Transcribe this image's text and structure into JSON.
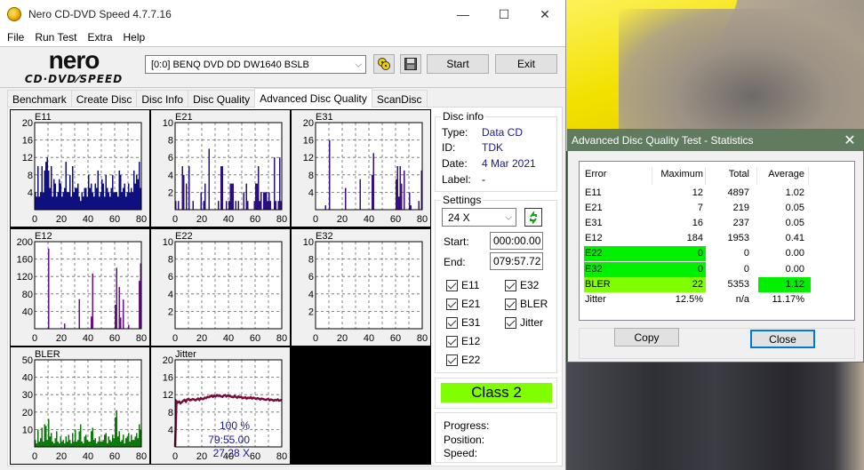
{
  "window": {
    "title": "Nero CD-DVD Speed 4.7.7.16",
    "controls": {
      "minimize": "—",
      "maximize": "☐",
      "close": "✕"
    }
  },
  "menu": [
    "File",
    "Run Test",
    "Extra",
    "Help"
  ],
  "toolbar": {
    "logo_top": "nero",
    "logo_bottom": "CD·DVD⁄SPEED",
    "drive": "[0:0]   BENQ DVD DD DW1640 BSLB",
    "start_label": "Start",
    "exit_label": "Exit"
  },
  "tabs": [
    {
      "label": "Benchmark",
      "active": false
    },
    {
      "label": "Create Disc",
      "active": false
    },
    {
      "label": "Disc Info",
      "active": false
    },
    {
      "label": "Disc Quality",
      "active": false
    },
    {
      "label": "Advanced Disc Quality",
      "active": true
    },
    {
      "label": "ScanDisc",
      "active": false
    }
  ],
  "disc_info": {
    "legend": "Disc info",
    "type_label": "Type:",
    "type": "Data CD",
    "id_label": "ID:",
    "id": "TDK",
    "date_label": "Date:",
    "date": "4 Mar 2021",
    "label_label": "Label:",
    "label": "-"
  },
  "settings": {
    "legend": "Settings",
    "speed": "24 X",
    "start_label": "Start:",
    "start": "000:00.00",
    "end_label": "End:",
    "end": "079:57.72",
    "checkboxes": [
      {
        "label": "E11",
        "checked": true
      },
      {
        "label": "E21",
        "checked": true
      },
      {
        "label": "E31",
        "checked": true
      },
      {
        "label": "E12",
        "checked": true
      },
      {
        "label": "E22",
        "checked": true
      },
      {
        "label": "E32",
        "checked": true
      },
      {
        "label": "BLER",
        "checked": true
      },
      {
        "label": "Jitter",
        "checked": true
      }
    ]
  },
  "class": {
    "label": "Class 2",
    "color": "#80ff00"
  },
  "progress": {
    "progress_label": "Progress:",
    "progress": "100 %",
    "position_label": "Position:",
    "position": "79:55.00",
    "speed_label": "Speed:",
    "speed": "27.28 X"
  },
  "chart_data": [
    {
      "type": "bar",
      "title": "E11",
      "xlim": [
        0,
        80
      ],
      "ylim": [
        0,
        20
      ],
      "xticks": [
        "0",
        "20",
        "40",
        "60",
        "80"
      ],
      "yticks": [
        "4",
        "8",
        "12",
        "16",
        "20"
      ],
      "color": "#0f0f80",
      "grid": true,
      "values": [
        4,
        3,
        10,
        3,
        4,
        10,
        4,
        9,
        11,
        12,
        9,
        5,
        10,
        3,
        7,
        6,
        3,
        4,
        7,
        6,
        3,
        4,
        5,
        11,
        4,
        4,
        8,
        3,
        10,
        4,
        5,
        5,
        6,
        3,
        2,
        4,
        3,
        5,
        5,
        3,
        8,
        5,
        6,
        4,
        3,
        6,
        5,
        9,
        3,
        4,
        7,
        6,
        3,
        8,
        5,
        4,
        3,
        5,
        8,
        4,
        4,
        4,
        3,
        9,
        8,
        4,
        5,
        6,
        3,
        4,
        6,
        4,
        5,
        4,
        9,
        6,
        8,
        7,
        11,
        5
      ]
    },
    {
      "type": "bar",
      "title": "E21",
      "xlim": [
        0,
        80
      ],
      "ylim": [
        0,
        10
      ],
      "xticks": [
        "0",
        "20",
        "40",
        "60",
        "80"
      ],
      "yticks": [
        "2",
        "4",
        "6",
        "8",
        "10"
      ],
      "color": "#2a0f80",
      "grid": true,
      "values": [
        1,
        0,
        1,
        0,
        0,
        5,
        4,
        0,
        3,
        0,
        5,
        0,
        0,
        1,
        0,
        0,
        0,
        0,
        0,
        2,
        0,
        1,
        3,
        0,
        0,
        7,
        0,
        0,
        0,
        0,
        0,
        0,
        1,
        0,
        5,
        5,
        0,
        0,
        1,
        0,
        1,
        3,
        3,
        3,
        0,
        1,
        0,
        1,
        0,
        0,
        0,
        2,
        0,
        3,
        1,
        0,
        0,
        0,
        0,
        1,
        3,
        3,
        5,
        1,
        2,
        0,
        2,
        2,
        2,
        1,
        2,
        1,
        0,
        0,
        6,
        1,
        0,
        1,
        6,
        1
      ]
    },
    {
      "type": "bar",
      "title": "E31",
      "xlim": [
        0,
        80
      ],
      "ylim": [
        0,
        20
      ],
      "xticks": [
        "0",
        "20",
        "40",
        "60",
        "80"
      ],
      "yticks": [
        "4",
        "8",
        "12",
        "16",
        "20"
      ],
      "color": "#3a0f80",
      "grid": true,
      "values": [
        0,
        0,
        0,
        0,
        0,
        0,
        0,
        1,
        0,
        0,
        16,
        0,
        0,
        0,
        0,
        0,
        0,
        0,
        0,
        0,
        0,
        0,
        5,
        0,
        0,
        0,
        0,
        0,
        0,
        0,
        0,
        0,
        0,
        7,
        0,
        0,
        0,
        0,
        0,
        0,
        0,
        0,
        8,
        13,
        0,
        0,
        0,
        0,
        0,
        0,
        0,
        0,
        0,
        0,
        0,
        0,
        0,
        0,
        0,
        0,
        7,
        10,
        3,
        10,
        6,
        0,
        9,
        0,
        0,
        0,
        4,
        1,
        0,
        0,
        0,
        0,
        0,
        2,
        0,
        9
      ]
    },
    {
      "type": "bar",
      "title": "E12",
      "xlim": [
        0,
        80
      ],
      "ylim": [
        0,
        200
      ],
      "xticks": [
        "0",
        "20",
        "40",
        "60",
        "80"
      ],
      "yticks": [
        "40",
        "80",
        "120",
        "160",
        "200"
      ],
      "color": "#6a0f8a",
      "grid": true,
      "values": [
        0,
        0,
        0,
        0,
        0,
        0,
        0,
        0,
        0,
        0,
        184,
        0,
        0,
        0,
        0,
        0,
        0,
        0,
        0,
        0,
        0,
        0,
        12,
        0,
        0,
        0,
        0,
        0,
        0,
        0,
        0,
        0,
        0,
        68,
        0,
        0,
        0,
        0,
        0,
        0,
        0,
        0,
        28,
        127,
        0,
        0,
        0,
        0,
        0,
        0,
        0,
        0,
        0,
        0,
        0,
        0,
        0,
        0,
        0,
        0,
        55,
        140,
        0,
        96,
        26,
        0,
        67,
        0,
        0,
        0,
        9,
        0,
        0,
        0,
        0,
        0,
        0,
        0,
        110,
        150
      ]
    },
    {
      "type": "bar",
      "title": "E22",
      "xlim": [
        0,
        80
      ],
      "ylim": [
        0,
        10
      ],
      "xticks": [
        "0",
        "20",
        "40",
        "60",
        "80"
      ],
      "yticks": [
        "2",
        "4",
        "6",
        "8",
        "10"
      ],
      "color": "#2a0f80",
      "grid": true,
      "values": []
    },
    {
      "type": "bar",
      "title": "E32",
      "xlim": [
        0,
        80
      ],
      "ylim": [
        0,
        10
      ],
      "xticks": [
        "0",
        "20",
        "40",
        "60",
        "80"
      ],
      "yticks": [
        "2",
        "4",
        "6",
        "8",
        "10"
      ],
      "color": "#2a0f80",
      "grid": true,
      "values": []
    },
    {
      "type": "bar",
      "title": "BLER",
      "xlim": [
        0,
        80
      ],
      "ylim": [
        0,
        50
      ],
      "xticks": [
        "0",
        "20",
        "40",
        "60",
        "80"
      ],
      "yticks": [
        "10",
        "20",
        "30",
        "40",
        "50"
      ],
      "color": "#0a7a0a",
      "grid": true,
      "values": [
        4,
        2,
        10,
        3,
        5,
        11,
        3,
        13,
        12,
        4,
        16,
        6,
        8,
        3,
        2,
        5,
        9,
        3,
        2,
        6,
        3,
        4,
        2,
        6,
        3,
        7,
        4,
        2,
        8,
        3,
        10,
        3,
        4,
        9,
        13,
        3,
        2,
        6,
        7,
        4,
        3,
        3,
        9,
        11,
        4,
        5,
        2,
        3,
        6,
        3,
        3,
        4,
        7,
        8,
        2,
        6,
        4,
        3,
        7,
        5,
        17,
        21,
        6,
        9,
        3,
        4,
        7,
        2,
        5,
        6,
        8,
        3,
        7,
        4,
        4,
        6,
        8,
        5,
        13,
        10
      ]
    },
    {
      "type": "line",
      "title": "Jitter",
      "xlim": [
        0,
        80
      ],
      "ylim": [
        0,
        20
      ],
      "xticks": [
        "0",
        "20",
        "40",
        "60",
        "80"
      ],
      "yticks": [
        "4",
        "8",
        "12",
        "16",
        "20"
      ],
      "color": "#7a0a3a",
      "grid": true,
      "values": [
        0,
        10.5,
        10.2,
        10.4,
        10.0,
        10.3,
        10.6,
        10.8,
        10.4,
        10.9,
        11.0,
        10.7,
        10.8,
        11.0,
        10.9,
        10.7,
        10.9,
        11.1,
        10.8,
        11.2,
        11.0,
        11.0,
        11.3,
        11.2,
        11.5,
        11.4,
        11.6,
        11.8,
        11.5,
        11.7,
        11.6,
        11.9,
        11.7,
        11.8,
        11.6,
        11.5,
        11.8,
        11.9,
        11.6,
        11.8,
        11.7,
        11.6,
        11.5,
        11.4,
        11.7,
        11.5,
        11.3,
        11.6,
        11.4,
        11.5,
        11.2,
        11.3,
        11.4,
        11.1,
        11.3,
        11.2,
        11.4,
        11.1,
        11.3,
        11.2,
        11.0,
        11.2,
        11.1,
        10.9,
        11.1,
        11.0,
        10.9,
        10.8,
        10.9,
        11.0,
        10.7,
        10.9,
        10.8,
        10.6,
        10.8,
        10.7,
        10.9,
        10.6,
        10.7,
        10.8
      ]
    }
  ],
  "stats_dialog": {
    "title": "Advanced Disc Quality Test - Statistics",
    "columns": [
      "Error",
      "Maximum",
      "Total",
      "Average"
    ],
    "rows": [
      {
        "error": "E11",
        "maximum": "12",
        "total": "4897",
        "average": "1.02",
        "max_hl": "",
        "avg_hl": ""
      },
      {
        "error": "E21",
        "maximum": "7",
        "total": "219",
        "average": "0.05",
        "max_hl": "",
        "avg_hl": ""
      },
      {
        "error": "E31",
        "maximum": "16",
        "total": "237",
        "average": "0.05",
        "max_hl": "",
        "avg_hl": ""
      },
      {
        "error": "E12",
        "maximum": "184",
        "total": "1953",
        "average": "0.41",
        "max_hl": "",
        "avg_hl": ""
      },
      {
        "error": "E22",
        "maximum": "0",
        "total": "0",
        "average": "0.00",
        "max_hl": "#00f000",
        "avg_hl": ""
      },
      {
        "error": "E32",
        "maximum": "0",
        "total": "0",
        "average": "0.00",
        "max_hl": "#00f000",
        "avg_hl": ""
      },
      {
        "error": "BLER",
        "maximum": "22",
        "total": "5353",
        "average": "1.12",
        "max_hl": "#80ff00",
        "avg_hl": "#00f000"
      },
      {
        "error": "Jitter",
        "maximum": "12.5%",
        "total": "n/a",
        "average": "11.17%",
        "max_hl": "",
        "avg_hl": ""
      }
    ],
    "copy_label": "Copy",
    "close_label": "Close"
  }
}
